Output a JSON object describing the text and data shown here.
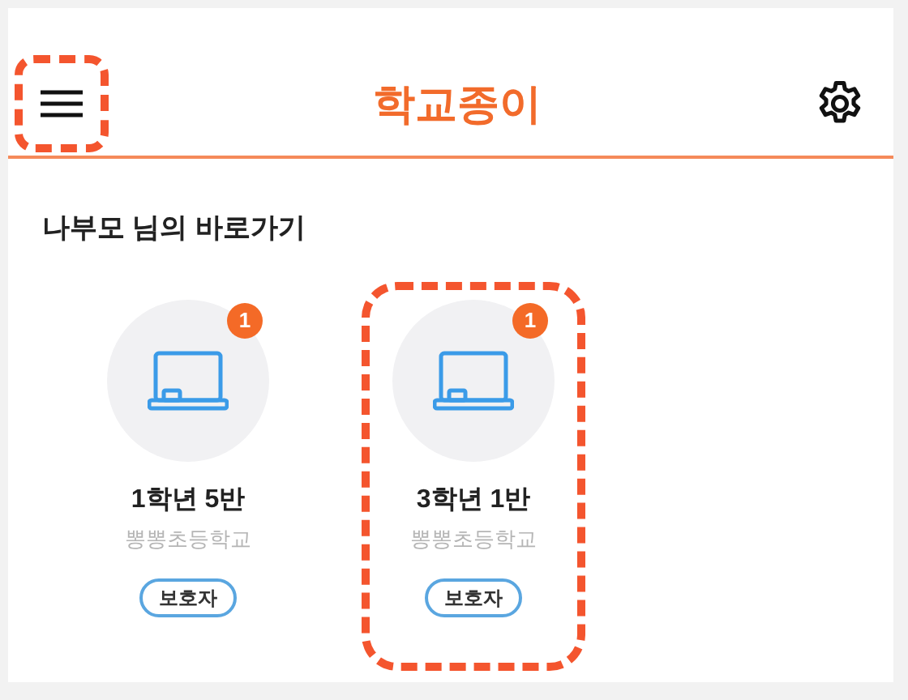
{
  "header": {
    "menu_button": {
      "highlighted": true
    },
    "title": "학교종이"
  },
  "section": {
    "title": "나부모 님의 바로가기"
  },
  "classes": [
    {
      "name": "1학년 5반",
      "school": "뽕뽕초등학교",
      "role": "보호자",
      "count": "1",
      "highlighted": false
    },
    {
      "name": "3학년 1반",
      "school": "뽕뽕초등학교",
      "role": "보호자",
      "count": "1",
      "highlighted": true
    }
  ]
}
